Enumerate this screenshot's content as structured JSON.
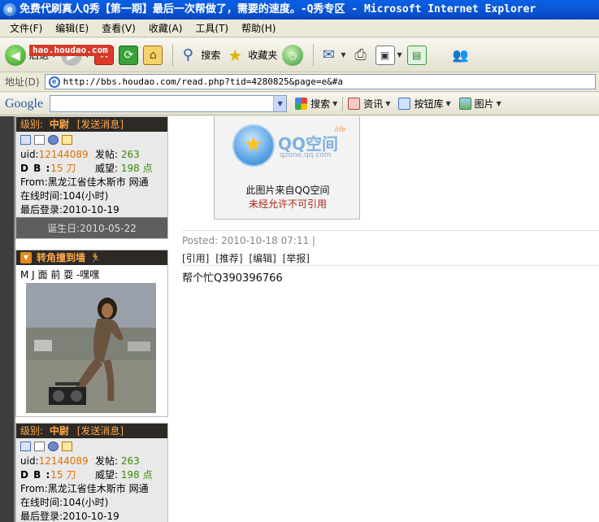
{
  "window": {
    "title": "免费代刷真人Q秀【第一期】最后一次帮做了，需要的速度。-Q秀专区 - Microsoft Internet Explorer",
    "watermark": "hao.houdao.com"
  },
  "menu": [
    "文件(F)",
    "编辑(E)",
    "查看(V)",
    "收藏(A)",
    "工具(T)",
    "帮助(H)"
  ],
  "toolbar": {
    "back": "后退",
    "search": "搜索",
    "favorites": "收藏夹"
  },
  "address": {
    "label": "地址(D)",
    "url": "http://bbs.houdao.com/read.php?tid=4280825&page=e&#a"
  },
  "google": {
    "logo": "Google",
    "search_label": "搜索",
    "news_label": "资讯",
    "buttons_label": "按钮库",
    "images_label": "图片"
  },
  "profile": {
    "rank_label": "级别:",
    "rank": "中尉",
    "send_message": "[发送消息]",
    "uid_label": "uid:",
    "uid": "12144089",
    "posts_label": "发帖:",
    "posts": "263",
    "db_label": "D B :",
    "db": "15 刀",
    "prestige_label": "威望:",
    "prestige": "198 点",
    "from": "From:黑龙江省佳木斯市 网通",
    "online": "在线时间:104(小时)",
    "last_login": "最后登录:2010-10-19",
    "birthday": "诞生日:2010-05-22"
  },
  "corner": {
    "title": "转角撞到墙",
    "text": "M J  面 前 耍  -嘿嘿"
  },
  "qq_card": {
    "brand": "QQ空间",
    "life": "life",
    "domain": "qzone.qq.com",
    "line1": "此图片来自QQ空间",
    "line2": "未经允许不可引用"
  },
  "post": {
    "posted": "Posted: 2010-10-18 07:11 |",
    "actions": [
      "[引用]",
      "[推荐]",
      "[编辑]",
      "[举报]"
    ],
    "body": "帮个忙Q390396766"
  },
  "colors": {
    "titlebar": "#0b58d8",
    "rank_bar": "#2d2a25",
    "rank_text": "#ffa84c",
    "uid": "#e07000",
    "prestige": "#3a8a00"
  }
}
